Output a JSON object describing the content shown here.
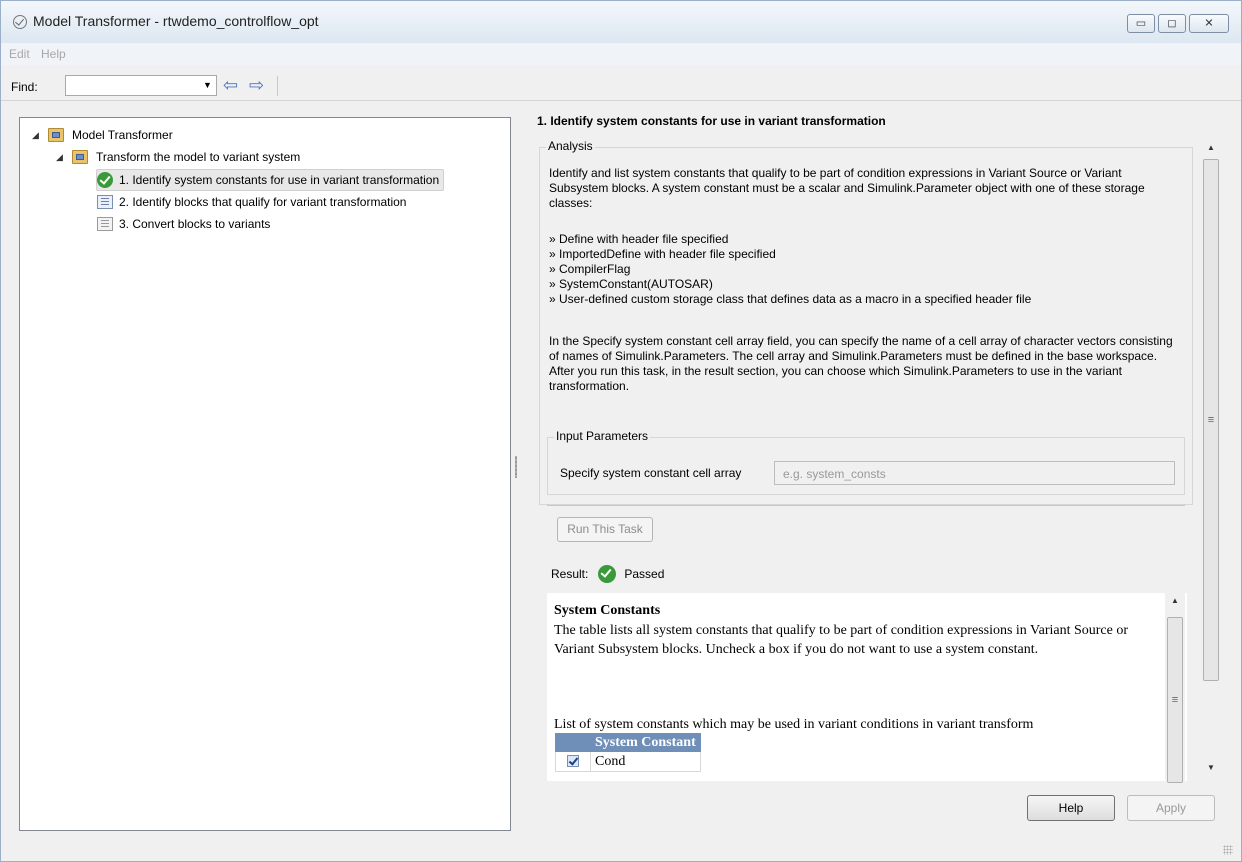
{
  "window": {
    "title": "Model Transformer - rtwdemo_controlflow_opt"
  },
  "menu": {
    "edit": "Edit",
    "help": "Help"
  },
  "toolbar": {
    "find_label": "Find:",
    "find_value": ""
  },
  "tree": {
    "root": "Model Transformer",
    "group": "Transform the model to variant system",
    "tasks": [
      {
        "label": "1. Identify system constants for use in variant transformation",
        "status": "passed"
      },
      {
        "label": "2. Identify blocks that qualify for variant transformation",
        "status": "not-run"
      },
      {
        "label": "3. Convert blocks to variants",
        "status": "not-run"
      }
    ]
  },
  "detail": {
    "title": "1. Identify system constants for use in variant transformation",
    "analysis_label": "Analysis",
    "analysis_intro": "Identify and list system constants that qualify to be part of condition expressions in Variant Source or Variant Subsystem blocks. A system constant must be a scalar and Simulink.Parameter object with one of these storage classes:",
    "storage_classes": [
      "» Define with header file specified",
      "» ImportedDefine with header file specified",
      "» CompilerFlag",
      "» SystemConstant(AUTOSAR)",
      "» User-defined custom storage class that defines data as a macro in a specified header file"
    ],
    "analysis_note": "In the Specify system constant cell array field, you can specify the name of a cell array of character vectors consisting of names of Simulink.Parameters. The cell array and Simulink.Parameters must be defined in the base workspace. After you run this task, in the result section, you can choose which Simulink.Parameters to use in the variant transformation.",
    "input_params_label": "Input Parameters",
    "field_label": "Specify system constant cell array",
    "field_placeholder": "e.g. system_consts",
    "run_button": "Run This Task",
    "result_label": "Result:",
    "result_status": "Passed"
  },
  "result": {
    "heading": "System Constants",
    "description": "The table lists all system constants that qualify to be part of condition expressions in Variant Source or Variant Subsystem blocks. Uncheck a box if you do not want to use a system constant.",
    "list_caption": "List of system constants which may be used in variant conditions in variant transform",
    "table_header": "System Constant",
    "rows": [
      {
        "name": "Cond",
        "checked": true
      }
    ]
  },
  "buttons": {
    "help": "Help",
    "apply": "Apply"
  }
}
